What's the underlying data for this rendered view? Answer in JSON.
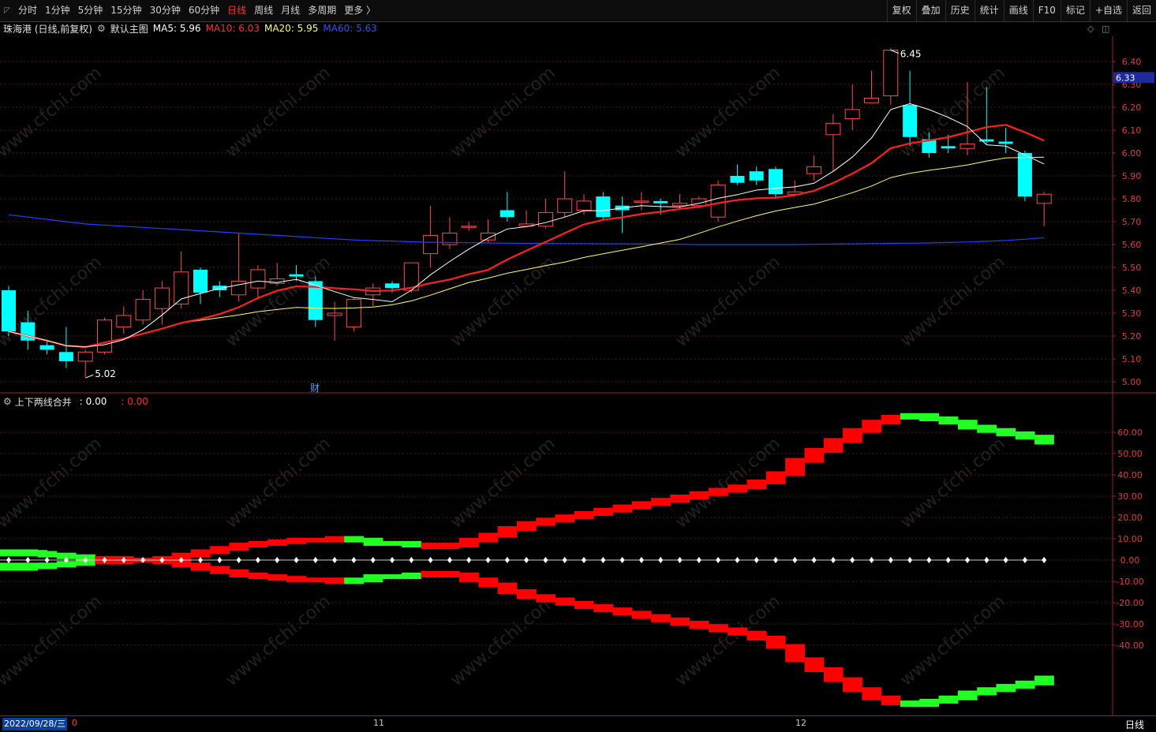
{
  "toolbar": {
    "periods": [
      "分时",
      "1分钟",
      "5分钟",
      "15分钟",
      "30分钟",
      "60分钟",
      "日线",
      "周线",
      "月线",
      "多周期",
      "更多 〉"
    ],
    "active_period": "日线",
    "right_buttons": [
      "复权",
      "叠加",
      "历史",
      "统计",
      "画线",
      "F10",
      "标记",
      "+自选",
      "返回"
    ]
  },
  "info": {
    "stock": "珠海港 (日线,前复权)",
    "template": "默认主图",
    "ma5": "MA5: 5.96",
    "ma10": "MA10: 6.03",
    "ma20": "MA20: 5.95",
    "ma60": "MA60: 5.63"
  },
  "indicator": {
    "name": "上下两线合并",
    "v1": ": 0.00",
    "v2": ": 0.00"
  },
  "colors": {
    "up": "#ff4a4a",
    "down": "#00ffff",
    "ma5": "#ffffff",
    "ma10": "#ff2020",
    "ma20": "#ffff66",
    "ma60": "#2040ff",
    "ind_red": "#ff0000",
    "ind_green": "#22ff22",
    "axis": "#e03c3c"
  },
  "main_axis": {
    "ticks": [
      "6.40",
      "6.30",
      "6.20",
      "6.10",
      "6.00",
      "5.90",
      "5.80",
      "5.70",
      "5.60",
      "5.50",
      "5.40",
      "5.30",
      "5.20",
      "5.10",
      "5.00"
    ],
    "current_price": "6.33",
    "high_label": "6.45",
    "low_label": "5.02",
    "marker": "财"
  },
  "ind_axis": {
    "ticks": [
      "60.00",
      "50.00",
      "40.00",
      "30.00",
      "20.00",
      "10.00",
      "0.00",
      "-10.00",
      "-20.00",
      "-30.00",
      "-40.00"
    ]
  },
  "bottom": {
    "date": "2022/09/28/三",
    "month_start": "0",
    "months": [
      "11",
      "12"
    ],
    "period": "日线"
  },
  "watermark": "www.cfchi.com",
  "chart_data": {
    "type": "candlestick",
    "ylim": [
      5.0,
      6.45
    ],
    "candles": [
      [
        5.4,
        5.22,
        5.42,
        5.2
      ],
      [
        5.26,
        5.18,
        5.31,
        5.14
      ],
      [
        5.16,
        5.14,
        5.18,
        5.12
      ],
      [
        5.13,
        5.09,
        5.24,
        5.06
      ],
      [
        5.09,
        5.13,
        5.14,
        5.02
      ],
      [
        5.13,
        5.27,
        5.28,
        5.12
      ],
      [
        5.24,
        5.29,
        5.33,
        5.21
      ],
      [
        5.27,
        5.36,
        5.4,
        5.25
      ],
      [
        5.32,
        5.41,
        5.44,
        5.25
      ],
      [
        5.34,
        5.48,
        5.57,
        5.32
      ],
      [
        5.49,
        5.39,
        5.5,
        5.34
      ],
      [
        5.42,
        5.4,
        5.44,
        5.37
      ],
      [
        5.38,
        5.44,
        5.65,
        5.35
      ],
      [
        5.41,
        5.49,
        5.51,
        5.36
      ],
      [
        5.43,
        5.45,
        5.52,
        5.42
      ],
      [
        5.47,
        5.46,
        5.51,
        5.44
      ],
      [
        5.44,
        5.27,
        5.46,
        5.24
      ],
      [
        5.29,
        5.3,
        5.35,
        5.18
      ],
      [
        5.24,
        5.36,
        5.37,
        5.22
      ],
      [
        5.38,
        5.41,
        5.43,
        5.33
      ],
      [
        5.43,
        5.41,
        5.44,
        5.39
      ],
      [
        5.4,
        5.52,
        5.52,
        5.39
      ],
      [
        5.56,
        5.64,
        5.77,
        5.5
      ],
      [
        5.6,
        5.65,
        5.72,
        5.58
      ],
      [
        5.68,
        5.68,
        5.7,
        5.66
      ],
      [
        5.62,
        5.65,
        5.71,
        5.61
      ],
      [
        5.75,
        5.72,
        5.83,
        5.7
      ],
      [
        5.68,
        5.69,
        5.75,
        5.68
      ],
      [
        5.68,
        5.74,
        5.8,
        5.67
      ],
      [
        5.74,
        5.8,
        5.92,
        5.72
      ],
      [
        5.75,
        5.79,
        5.82,
        5.73
      ],
      [
        5.81,
        5.72,
        5.83,
        5.71
      ],
      [
        5.77,
        5.75,
        5.81,
        5.65
      ],
      [
        5.79,
        5.79,
        5.83,
        5.75
      ],
      [
        5.79,
        5.78,
        5.8,
        5.73
      ],
      [
        5.77,
        5.78,
        5.82,
        5.75
      ],
      [
        5.77,
        5.8,
        5.81,
        5.76
      ],
      [
        5.72,
        5.86,
        5.88,
        5.7
      ],
      [
        5.9,
        5.87,
        5.95,
        5.86
      ],
      [
        5.92,
        5.88,
        5.94,
        5.86
      ],
      [
        5.93,
        5.82,
        5.94,
        5.8
      ],
      [
        5.82,
        5.83,
        5.88,
        5.81
      ],
      [
        5.91,
        5.94,
        5.99,
        5.88
      ],
      [
        6.08,
        6.13,
        6.17,
        5.92
      ],
      [
        6.15,
        6.19,
        6.3,
        6.1
      ],
      [
        6.22,
        6.24,
        6.36,
        6.22
      ],
      [
        6.25,
        6.45,
        6.46,
        6.21
      ],
      [
        6.21,
        6.07,
        6.36,
        6.03
      ],
      [
        6.06,
        6.0,
        6.09,
        5.98
      ],
      [
        6.03,
        6.02,
        6.08,
        6.0
      ],
      [
        6.02,
        6.04,
        6.31,
        5.99
      ],
      [
        6.06,
        6.05,
        6.29,
        6.04
      ],
      [
        6.05,
        6.04,
        6.11,
        6.0
      ],
      [
        6.0,
        5.81,
        6.01,
        5.79
      ],
      [
        5.78,
        5.82,
        5.83,
        5.68
      ]
    ],
    "ma_series": [
      "MA5",
      "MA10",
      "MA20",
      "MA60"
    ]
  }
}
